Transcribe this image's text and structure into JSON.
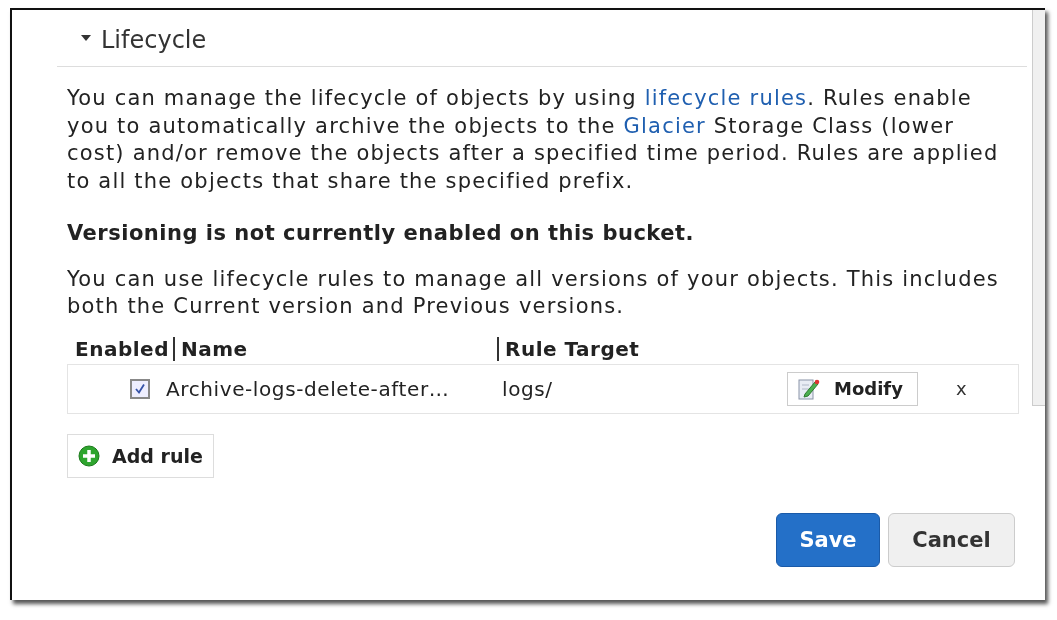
{
  "section": {
    "title": "Lifecycle",
    "expanded": true
  },
  "intro": [
    {
      "kind": "text",
      "text": "You can manage the lifecycle of objects by using "
    },
    {
      "kind": "link",
      "text": "lifecycle rules"
    },
    {
      "kind": "text",
      "text": ". Rules enable you to automatically archive the objects to the "
    },
    {
      "kind": "link",
      "text": "Glacier"
    },
    {
      "kind": "text",
      "text": " Storage Class (lower cost) and/or remove the objects after a specified time period. Rules are applied to all the objects that share the specified prefix."
    }
  ],
  "versioning_notice": "Versioning is not currently enabled on this bucket.",
  "versions_info": "You can use lifecycle rules to manage all versions of your objects. This includes both the Current version and Previous versions.",
  "table": {
    "columns": [
      "Enabled",
      "Name",
      "Rule Target"
    ],
    "rows": [
      {
        "enabled": true,
        "name": "Archive-logs-delete-after…",
        "target": "logs/",
        "modify": "Modify",
        "remove": "x"
      }
    ]
  },
  "add_rule": "Add rule",
  "buttons": [
    {
      "kind": "primary",
      "label": "Save"
    },
    {
      "kind": "secondary",
      "label": "Cancel"
    }
  ]
}
